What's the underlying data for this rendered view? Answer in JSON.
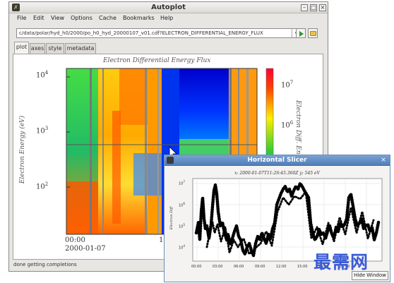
{
  "main_window": {
    "title": "Autoplot",
    "menu": [
      "File",
      "Edit",
      "View",
      "Options",
      "Cache",
      "Bookmarks",
      "Help"
    ],
    "path": "c/data/polar/hyd_h0/2000/po_h0_hyd_20000107_v01.cdf?ELECTRON_DIFFERENTIAL_ENERGY_FLUX",
    "tabs": [
      "plot",
      "axes",
      "style",
      "metadata"
    ],
    "status": "done getting completions",
    "icons": [
      "app-icon",
      "minimize-icon",
      "maximize-icon",
      "close-icon",
      "combo-arrow-icon",
      "play-icon",
      "folder-icon"
    ]
  },
  "chart_data": [
    {
      "type": "heatmap",
      "title": "Electron Differential Energy Flux",
      "xlabel": "",
      "ylabel": "Electron Energy (eV)",
      "colorbar_label": "Electron Diff. Energy Flux",
      "y_scale": "log",
      "y_ticks": [
        "10^2",
        "10^3",
        "10^4"
      ],
      "x_ticks": [
        "00:00",
        "12:00"
      ],
      "x_sublabel": "2000-01-07",
      "colorbar_ticks": [
        "10^6",
        "10^7"
      ],
      "colors": {
        "low": "#0000ff",
        "mid": "#33cc33",
        "high": "#ff2200",
        "top": "#ff0033"
      }
    },
    {
      "type": "scatter",
      "title": "Horizontal Slicer",
      "info": "x: 2000-01-07T11:26:45.360Z y: 545 eV",
      "ylabel": "Electron Diff",
      "y_scale": "log",
      "y_ticks": [
        "10^4",
        "10^5",
        "10^6",
        "10^7"
      ],
      "x_ticks": [
        "00:00",
        "03:00",
        "06:00",
        "09:00",
        "12:00",
        "15:00",
        "18:00",
        "21:00"
      ],
      "hide_button": "Hide Window"
    }
  ],
  "watermark": "最需网"
}
